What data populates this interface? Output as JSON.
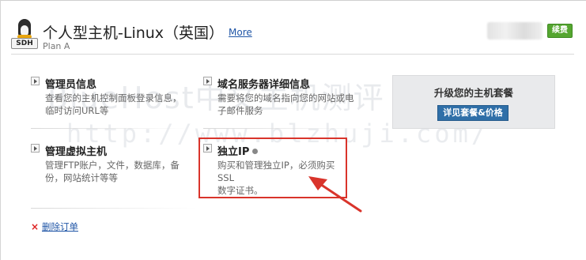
{
  "header": {
    "logo_text": "SDH",
    "title": "个人型主机-Linux（英国）",
    "more_label": "More",
    "subtitle": "Plan A",
    "renew_label": "续费"
  },
  "items": [
    {
      "title": "管理员信息",
      "desc_lines": [
        "查看您的主机控制面板登录信息，",
        "临时访问URL等"
      ]
    },
    {
      "title": "域名服务器详细信息",
      "desc_lines": [
        "需要将您的域名指向您的网站或电",
        "子邮件服务"
      ]
    },
    {
      "title": "管理虚拟主机",
      "desc_lines": [
        "管理FTP账户，文件，数据库，备",
        "份，网站统计等等"
      ]
    },
    {
      "title": "独立IP",
      "desc_lines": [
        "购买和管理独立IP，必须购买SSL",
        "数字证书。"
      ]
    }
  ],
  "upgrade": {
    "title": "升级您的主机套餐",
    "button_label": "详见套餐&价格"
  },
  "delete": {
    "icon": "×",
    "label": "删除订单"
  },
  "watermark": {
    "line1": "BlueHost中文主机测评",
    "line2": "http://www.blzhuji.com/"
  },
  "colors": {
    "link": "#1f55a6",
    "renew_button": "#55a630",
    "plans_button": "#2f6fa8",
    "highlight": "#d9342b"
  }
}
